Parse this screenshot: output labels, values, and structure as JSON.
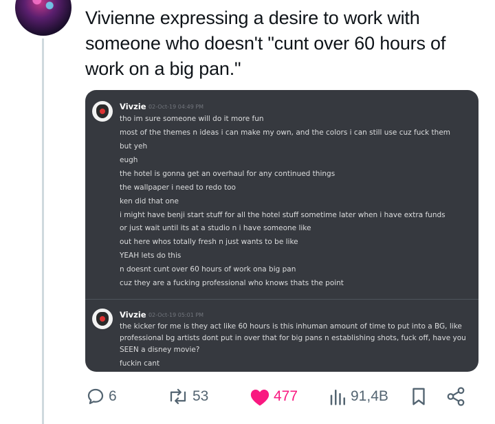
{
  "tweet": {
    "text": "Vivienne expressing a desire to work with someone who doesn't \"cunt over 60 hours of work on a big pan.\""
  },
  "discord": {
    "messages": [
      {
        "author": "Vivzie",
        "timestamp": "02-Oct-19 04:49 PM",
        "lines": [
          "tho im sure someone will do it more fun",
          "most of the themes n ideas i can make my own, and the colors i can still use cuz fuck them",
          "but yeh",
          "eugh",
          "the hotel is gonna get an overhaul for any continued things",
          "the wallpaper i need to redo too",
          "ken did that one",
          "i might have benji start stuff for all the hotel stuff sometime later when i have extra funds",
          "or just wait until its at a studio n i have someone like",
          "out here whos totally fresh n just wants to be like",
          "YEAH lets do this",
          "n doesnt cunt over 60 hours of work ona  big pan",
          "cuz they are a fucking professional who knows thats the point"
        ]
      },
      {
        "author": "Vivzie",
        "timestamp": "02-Oct-19 05:01 PM",
        "lines": [
          "the kicker for me is they act like 60 hours is this inhuman amount of time to put into a BG, like professional bg artists dont put in over that for big pans n establishing shots, fuck off, have you SEEN a disney movie?",
          "fuckin cant"
        ]
      }
    ]
  },
  "actions": {
    "replies": "6",
    "retweets": "53",
    "likes": "477",
    "views": "91,4B"
  },
  "colors": {
    "discord_bg": "#36393f",
    "like": "#f91880",
    "muted": "#536471"
  }
}
